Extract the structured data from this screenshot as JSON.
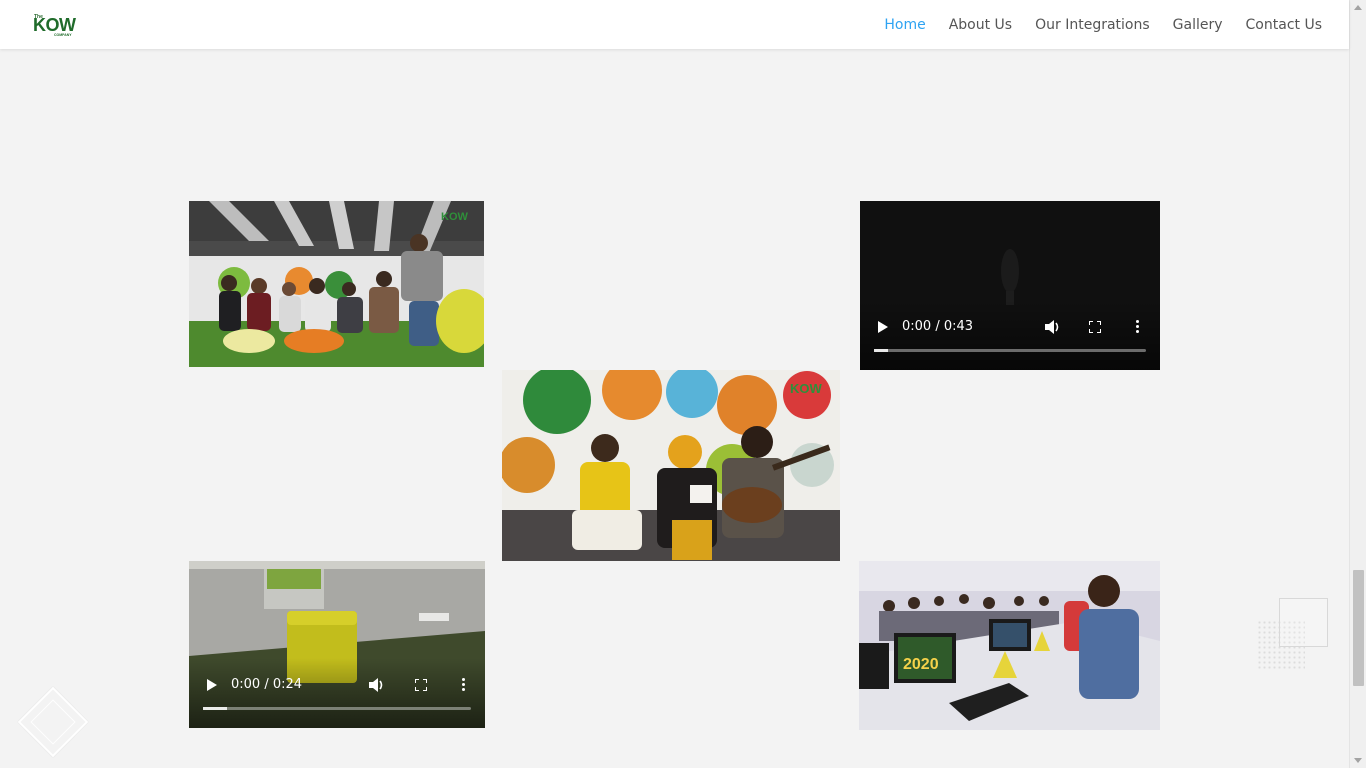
{
  "header": {
    "logo": {
      "small": "The",
      "big": "KOW",
      "sub": "COMPANY"
    },
    "nav": [
      {
        "label": "Home",
        "active": true
      },
      {
        "label": "About Us",
        "active": false
      },
      {
        "label": "Our Integrations",
        "active": false
      },
      {
        "label": "Gallery",
        "active": false
      },
      {
        "label": "Contact Us",
        "active": false
      }
    ]
  },
  "gallery": {
    "videos": [
      {
        "time": "0:00 / 0:43",
        "progress": 0.05
      },
      {
        "time": "0:00 / 0:24",
        "progress": 0.09
      }
    ],
    "images": [
      {
        "watermark": "KOW"
      },
      {
        "watermark": "KOW"
      },
      {
        "watermark": "2020"
      }
    ]
  },
  "colors": {
    "accent": "#2ea3f2",
    "brand": "#1f6b2a",
    "background": "#f3f3f3"
  }
}
